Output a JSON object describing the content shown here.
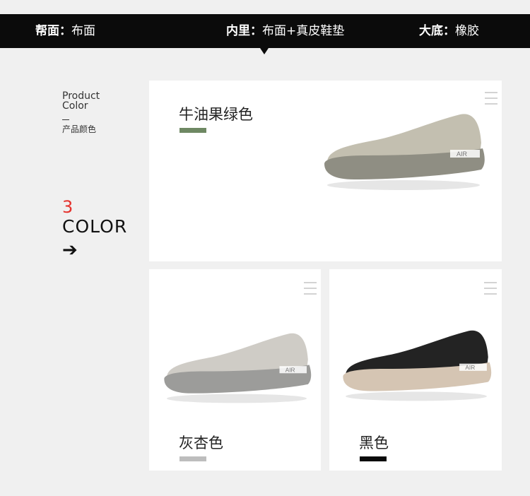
{
  "specs": [
    {
      "key": "帮面：",
      "value": "布面"
    },
    {
      "key": "内里：",
      "value": "布面+真皮鞋垫"
    },
    {
      "key": "大底：",
      "value": "橡胶"
    }
  ],
  "side": {
    "title_line1": "Product",
    "title_line2": "Color",
    "subtitle": "产品颜色",
    "count": "3",
    "color_word": "COLOR",
    "arrow": "➔"
  },
  "colors": [
    {
      "name": "牛油果绿色",
      "swatch": "#6e8863",
      "upper": "#c3bfb0",
      "sole": "#8f8e83"
    },
    {
      "name": "灰杏色",
      "swatch": "#bdbdbd",
      "upper": "#cfccc6",
      "sole": "#9c9c9a"
    },
    {
      "name": "黑色",
      "swatch": "#0a0a0a",
      "upper": "#232323",
      "sole": "#d5c5b3"
    }
  ],
  "shoe_label": "AIR"
}
